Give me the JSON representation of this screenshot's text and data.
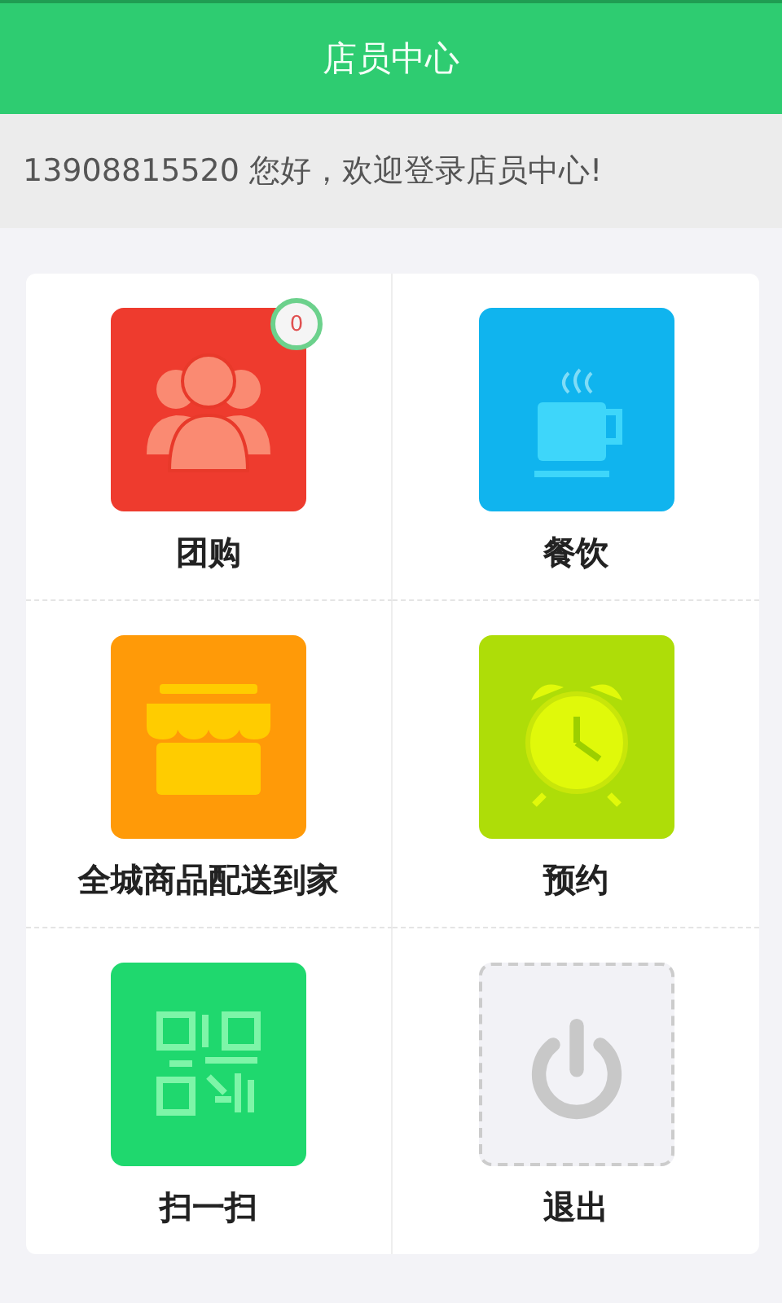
{
  "header": {
    "title": "店员中心"
  },
  "welcome": {
    "text": "13908815520 您好，欢迎登录店员中心!"
  },
  "tiles": [
    {
      "label": "团购",
      "kind": "group",
      "color": "#ee3b2e",
      "badge": "0"
    },
    {
      "label": "餐饮",
      "kind": "cup",
      "color": "#10b4ee"
    },
    {
      "label": "全城商品配送到家",
      "kind": "shop",
      "color": "#ff9a08"
    },
    {
      "label": "预约",
      "kind": "clock",
      "color": "#aedd08"
    },
    {
      "label": "扫一扫",
      "kind": "qr",
      "color": "#1fd86e"
    },
    {
      "label": "退出",
      "kind": "power",
      "color": "#f2f2f6"
    }
  ]
}
